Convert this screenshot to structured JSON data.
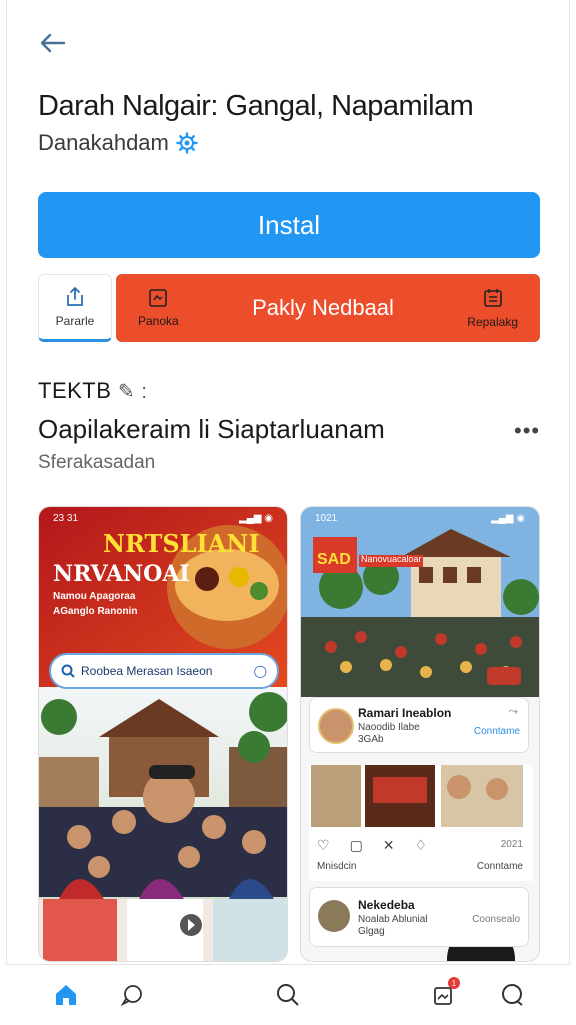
{
  "app": {
    "title": "Darah Nalgair: Gangal, Napamilam",
    "developer": "Danakahdam",
    "install_label": "Instal"
  },
  "actions": {
    "share_label": "Pararle",
    "left_label": "Panoka",
    "center_label": "Pakly Nedbaal",
    "right_label": "Repalakg"
  },
  "section": {
    "label": "TEKTB",
    "title": "Oapilakeraim li Siaptarluanam",
    "subtitle": "Sferakasadan"
  },
  "screenshot1": {
    "time": "23 31",
    "headline1": "NRTSLIANI",
    "headline2": "NRVANOAI",
    "line1": "Namou Apagoraa",
    "line2": "AGanglo Ranonin",
    "search_text": "Roobea Merasan Isaeon"
  },
  "screenshot2": {
    "time": "1021",
    "sign_text1": "SAD",
    "sign_text2": "Nanovuacaloar",
    "card1_title": "Ramari Ineablon",
    "card1_sub": "Naoodib Ilabe",
    "card1_sub2": "3GAb",
    "card1_action": "Conntame",
    "row_left": "Mnisdcin",
    "row_right": "Conntame",
    "row_num": "2021",
    "card2_title": "Nekedeba",
    "card2_sub": "Noalab Ablunial",
    "card2_sub2": "Glgag",
    "card2_action": "Coonsealo"
  },
  "colors": {
    "install": "#2196f3",
    "actionbar": "#ec4d2a",
    "accent": "#2d8fe0"
  },
  "nav": {
    "items": [
      "home-icon",
      "chat-icon",
      "search-icon",
      "notifications-icon",
      "profile-icon"
    ],
    "badge": "1"
  }
}
